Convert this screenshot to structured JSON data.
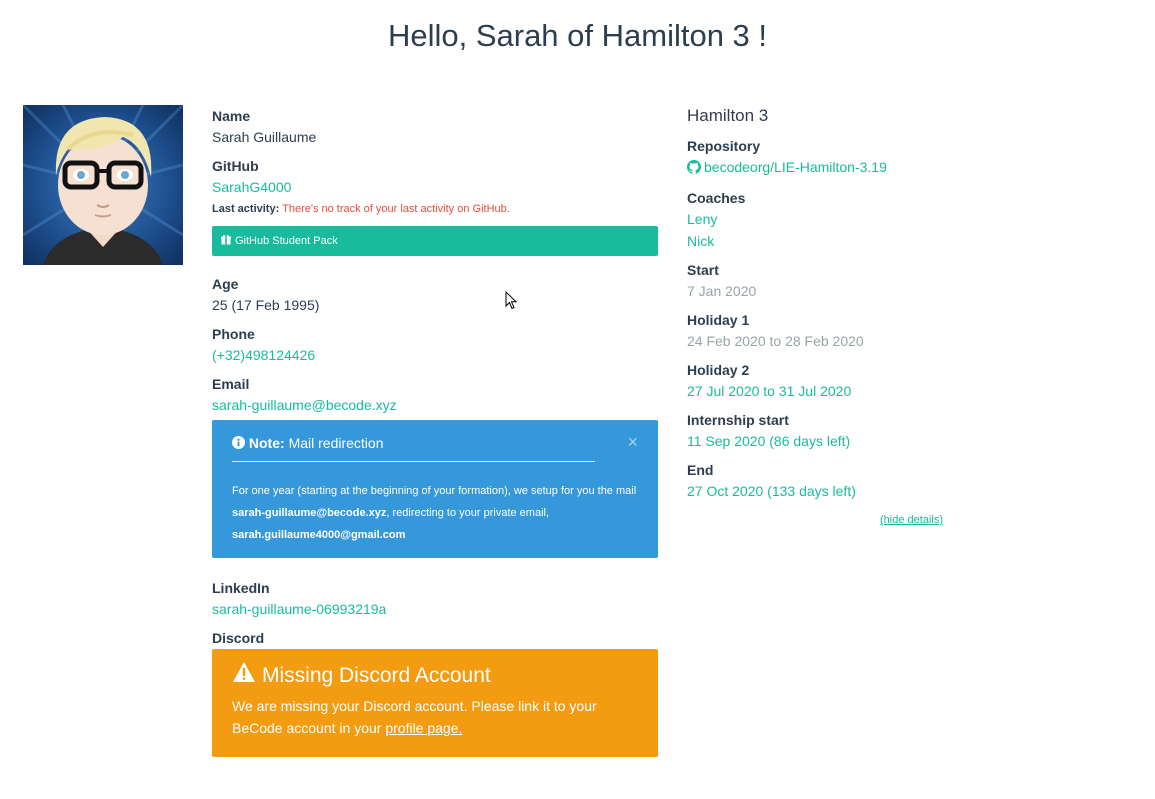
{
  "greeting": "Hello, Sarah of Hamilton 3 !",
  "profile": {
    "name_label": "Name",
    "name": "Sarah Guillaume",
    "github_label": "GitHub",
    "github": "SarahG4000",
    "last_activity_label": "Last activity:",
    "last_activity": "There's no track of your last activity on GitHub.",
    "student_pack": "GitHub Student Pack",
    "age_label": "Age",
    "age": "25 (17 Feb 1995)",
    "phone_label": "Phone",
    "phone": "(+32)498124426",
    "email_label": "Email",
    "email": "sarah-guillaume@becode.xyz",
    "note": {
      "title_bold": "Note:",
      "title": "Mail redirection",
      "close": "×",
      "body_1": "For one year (starting at the beginning of your formation), we setup for you the mail ",
      "body_mail": "sarah-guillaume@becode.xyz",
      "body_2": ", redirecting to your private email, ",
      "body_private": "sarah.guillaume4000@gmail.com"
    },
    "linkedin_label": "LinkedIn",
    "linkedin": "sarah-guillaume-06993219a",
    "discord_label": "Discord",
    "discord_alert": {
      "title": "Missing Discord Account",
      "body": "We are missing your Discord account. Please link it to your BeCode account in your ",
      "link": "profile page."
    }
  },
  "cohort": {
    "name": "Hamilton 3",
    "repository_label": "Repository",
    "repository": "becodeorg/LIE-Hamilton-3.19",
    "coaches_label": "Coaches",
    "coaches": [
      "Leny",
      "Nick"
    ],
    "start_label": "Start",
    "start": "7 Jan 2020",
    "holiday1_label": "Holiday 1",
    "holiday1": "24 Feb 2020 to 28 Feb 2020",
    "holiday2_label": "Holiday 2",
    "holiday2": "27 Jul 2020 to 31 Jul 2020",
    "internship_label": "Internship start",
    "internship": "11 Sep 2020 (86 days left)",
    "end_label": "End",
    "end": "27 Oct 2020 (133 days left)",
    "hide_details": "(hide details)"
  },
  "colors": {
    "primary": "#2c3e50",
    "success": "#18bc9c",
    "info": "#3498db",
    "warning": "#f39c12",
    "danger": "#e74c3c",
    "muted": "#95a5a6"
  },
  "icons": {
    "gift": "gift-icon",
    "info": "info-circle-icon",
    "warning": "warning-triangle-icon",
    "github": "github-icon",
    "close": "close-icon"
  }
}
